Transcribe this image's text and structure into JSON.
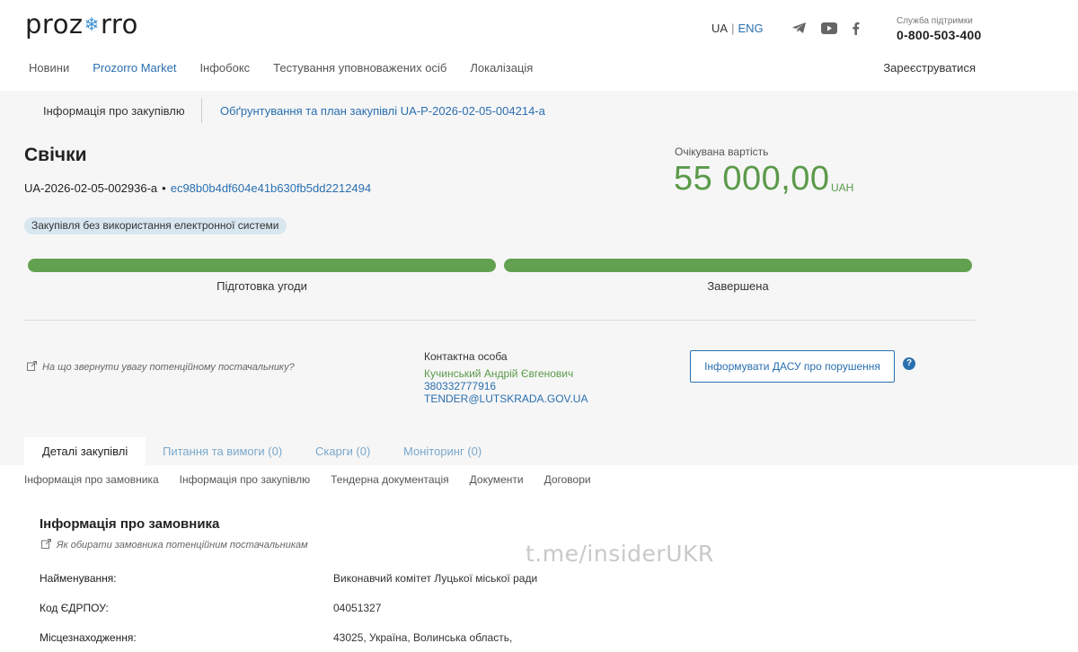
{
  "header": {
    "logo_left": "proz",
    "logo_right": "rro",
    "lang_ua": "UA",
    "lang_sep": "|",
    "lang_eng": "ENG",
    "support_label": "Служба підтримки",
    "support_phone": "0-800-503-400",
    "register": "Зареєструватися"
  },
  "nav": {
    "items": [
      "Новини",
      "Prozorro Market",
      "Інфобокс",
      "Тестування уповноважених осіб",
      "Локалізація"
    ]
  },
  "breadcrumb": {
    "info": "Інформація про закупівлю",
    "plan_link": "Обґрунтування та план закупівлі UA-P-2026-02-05-004214-a"
  },
  "tender": {
    "title": "Свічки",
    "id": "UA-2026-02-05-002936-a",
    "dot": "•",
    "hash": "ec98b0b4df604e41b630fb5dd2212494",
    "badge": "Закупівля без використання електронної системи",
    "value_label": "Очікувана вартість",
    "value_amount": "55 000,00",
    "value_currency": "UAH"
  },
  "stages": [
    {
      "label": "Підготовка угоди",
      "progress": 1.0
    },
    {
      "label": "Завершена",
      "progress": 1.0
    }
  ],
  "contact": {
    "attention_text": "На що звернути увагу потенційному постачальнику?",
    "label": "Контактна особа",
    "name": "Кучинський Андрій Євгенович",
    "phone": "380332777916",
    "email": "TENDER@LUTSKRADA.GOV.UA",
    "dasu_button": "Інформувати ДАСУ про порушення",
    "help": "?"
  },
  "tabs": [
    {
      "label": "Деталі закупівлі",
      "active": true
    },
    {
      "label": "Питання та вимоги (0)",
      "active": false
    },
    {
      "label": "Скарги (0)",
      "active": false
    },
    {
      "label": "Моніторинг (0)",
      "active": false
    }
  ],
  "subnav": [
    "Інформація про замовника",
    "Інформація про закупівлю",
    "Тендерна документація",
    "Документи",
    "Договори"
  ],
  "customer": {
    "title": "Інформація про замовника",
    "howto": "Як обирати замовника потенційним постачальникам",
    "rows": [
      {
        "label": "Найменування:",
        "value": "Виконавчий комітет Луцької міської ради"
      },
      {
        "label": "Код ЄДРПОУ:",
        "value": "04051327"
      },
      {
        "label": "Місцезнаходження:",
        "value": "43025, Україна, Волинська область,"
      }
    ]
  },
  "watermark": "t.me/insiderUKR",
  "colors": {
    "accent_blue": "#2a6fb0",
    "accent_green": "#5b9a4a",
    "progress_green": "#62a150",
    "background_gray": "#f6f6f6"
  }
}
